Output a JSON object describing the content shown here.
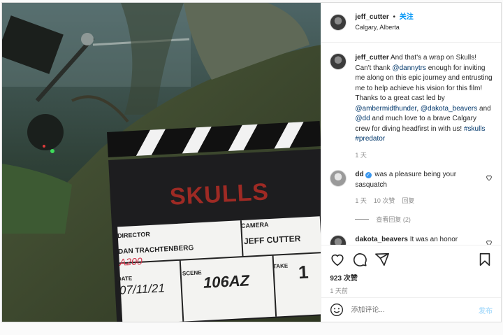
{
  "post": {
    "image": {
      "slate_title": "SKULLS",
      "director_label": "DIRECTOR",
      "director": "DAN TRACHTENBERG",
      "handwriting": "A200",
      "camera_label": "CAMERA",
      "camera": "JEFF CUTTER",
      "date_label": "DATE",
      "date": "07/11/21",
      "scene_label": "SCENE",
      "scene": "106AZ",
      "take_label": "TAKE",
      "take": "1"
    },
    "header": {
      "username": "jeff_cutter",
      "dot": "•",
      "follow_label": "关注",
      "location": "Calgary, Alberta"
    },
    "caption": {
      "username": "jeff_cutter",
      "t1": " And that's a wrap on Skulls! Can't thank ",
      "m1": "@dannytrs",
      "t2": " enough for inviting me along on this epic journey and entrusting me to help achieve his vision for this film! Thanks to a great cast led by ",
      "m2": "@ambermidthunder",
      "t3": ", ",
      "m3": "@dakota_beavers",
      "t4": " and ",
      "m4": "@dd",
      "t5": " and much love to a brave Calgary crew for diving headfirst in with us! ",
      "h1": "#skulls",
      "t6": " ",
      "h2": "#predator",
      "time": "1 天"
    },
    "comments": [
      {
        "username": "dd",
        "text": " was a pleasure being your sasquatch",
        "time": "1 天",
        "likes": "10 次赞",
        "reply": "回复"
      },
      {
        "username": "dakota_beavers",
        "text": " It was an honor"
      }
    ],
    "view_replies": "查看回复 (2)",
    "likes": "923 次赞",
    "posted": "1 天前",
    "add_comment": {
      "placeholder": "添加评论...",
      "post_label": "发布"
    }
  },
  "colors": {
    "accent": "#0095f6",
    "link": "#00376b",
    "muted": "#8e8e8e"
  },
  "icons": [
    "heart-icon",
    "comment-icon",
    "share-icon",
    "bookmark-icon",
    "emoji-icon",
    "verified-icon"
  ]
}
